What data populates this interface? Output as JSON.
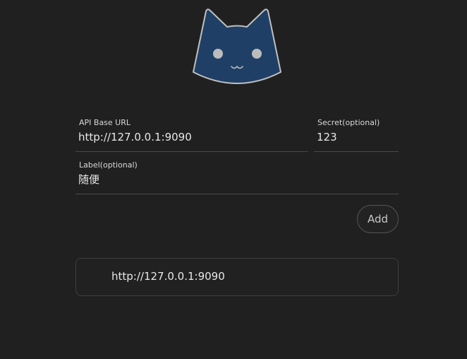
{
  "logo": {
    "icon": "cat-face-icon",
    "fill_color": "#1f3f66",
    "stroke_color": "#bfbfbf"
  },
  "form": {
    "base_url": {
      "label": "API Base URL",
      "value": "http://127.0.0.1:9090"
    },
    "secret": {
      "label": "Secret(optional)",
      "value": "123"
    },
    "label": {
      "label": "Label(optional)",
      "value": "随便"
    },
    "add_label": "Add"
  },
  "backends": [
    {
      "url": "http://127.0.0.1:9090"
    }
  ]
}
